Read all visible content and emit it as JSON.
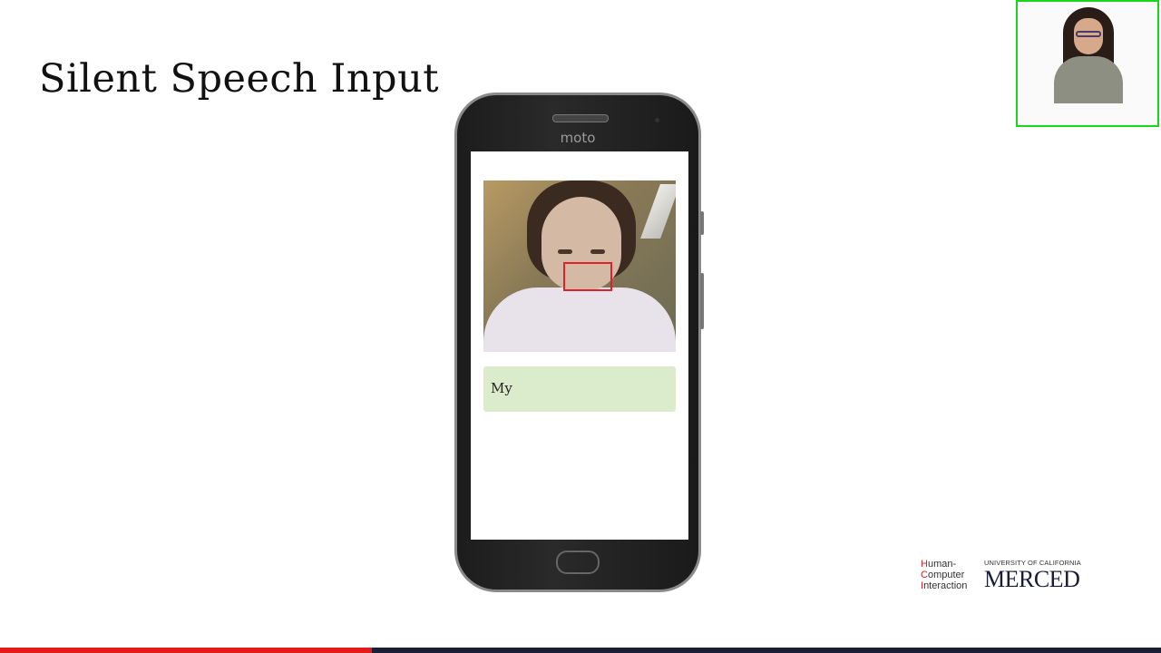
{
  "slide": {
    "title": "Silent Speech Input"
  },
  "phone": {
    "brand": "moto",
    "output_text": "My",
    "nav_icons": [
      "back-icon",
      "home-circle-icon",
      "recents-square-icon"
    ],
    "nav_glyphs": {
      "back": "◁",
      "home": "○",
      "recents": "□"
    }
  },
  "logo": {
    "hci_line1_initial": "H",
    "hci_line1_rest": "uman-",
    "hci_line2_initial": "C",
    "hci_line2_rest": "omputer",
    "hci_line3_initial": "I",
    "hci_line3_rest": "nteraction",
    "university": "UNIVERSITY OF CALIFORNIA",
    "campus": "MERCED"
  },
  "video_progress": {
    "played_fraction": 0.32
  },
  "colors": {
    "webcam_border": "#19d61a",
    "mouth_box": "#e0202a",
    "output_bg": "#dbeccd",
    "progress_played": "#e31b1b",
    "progress_track": "#1a1f36"
  }
}
